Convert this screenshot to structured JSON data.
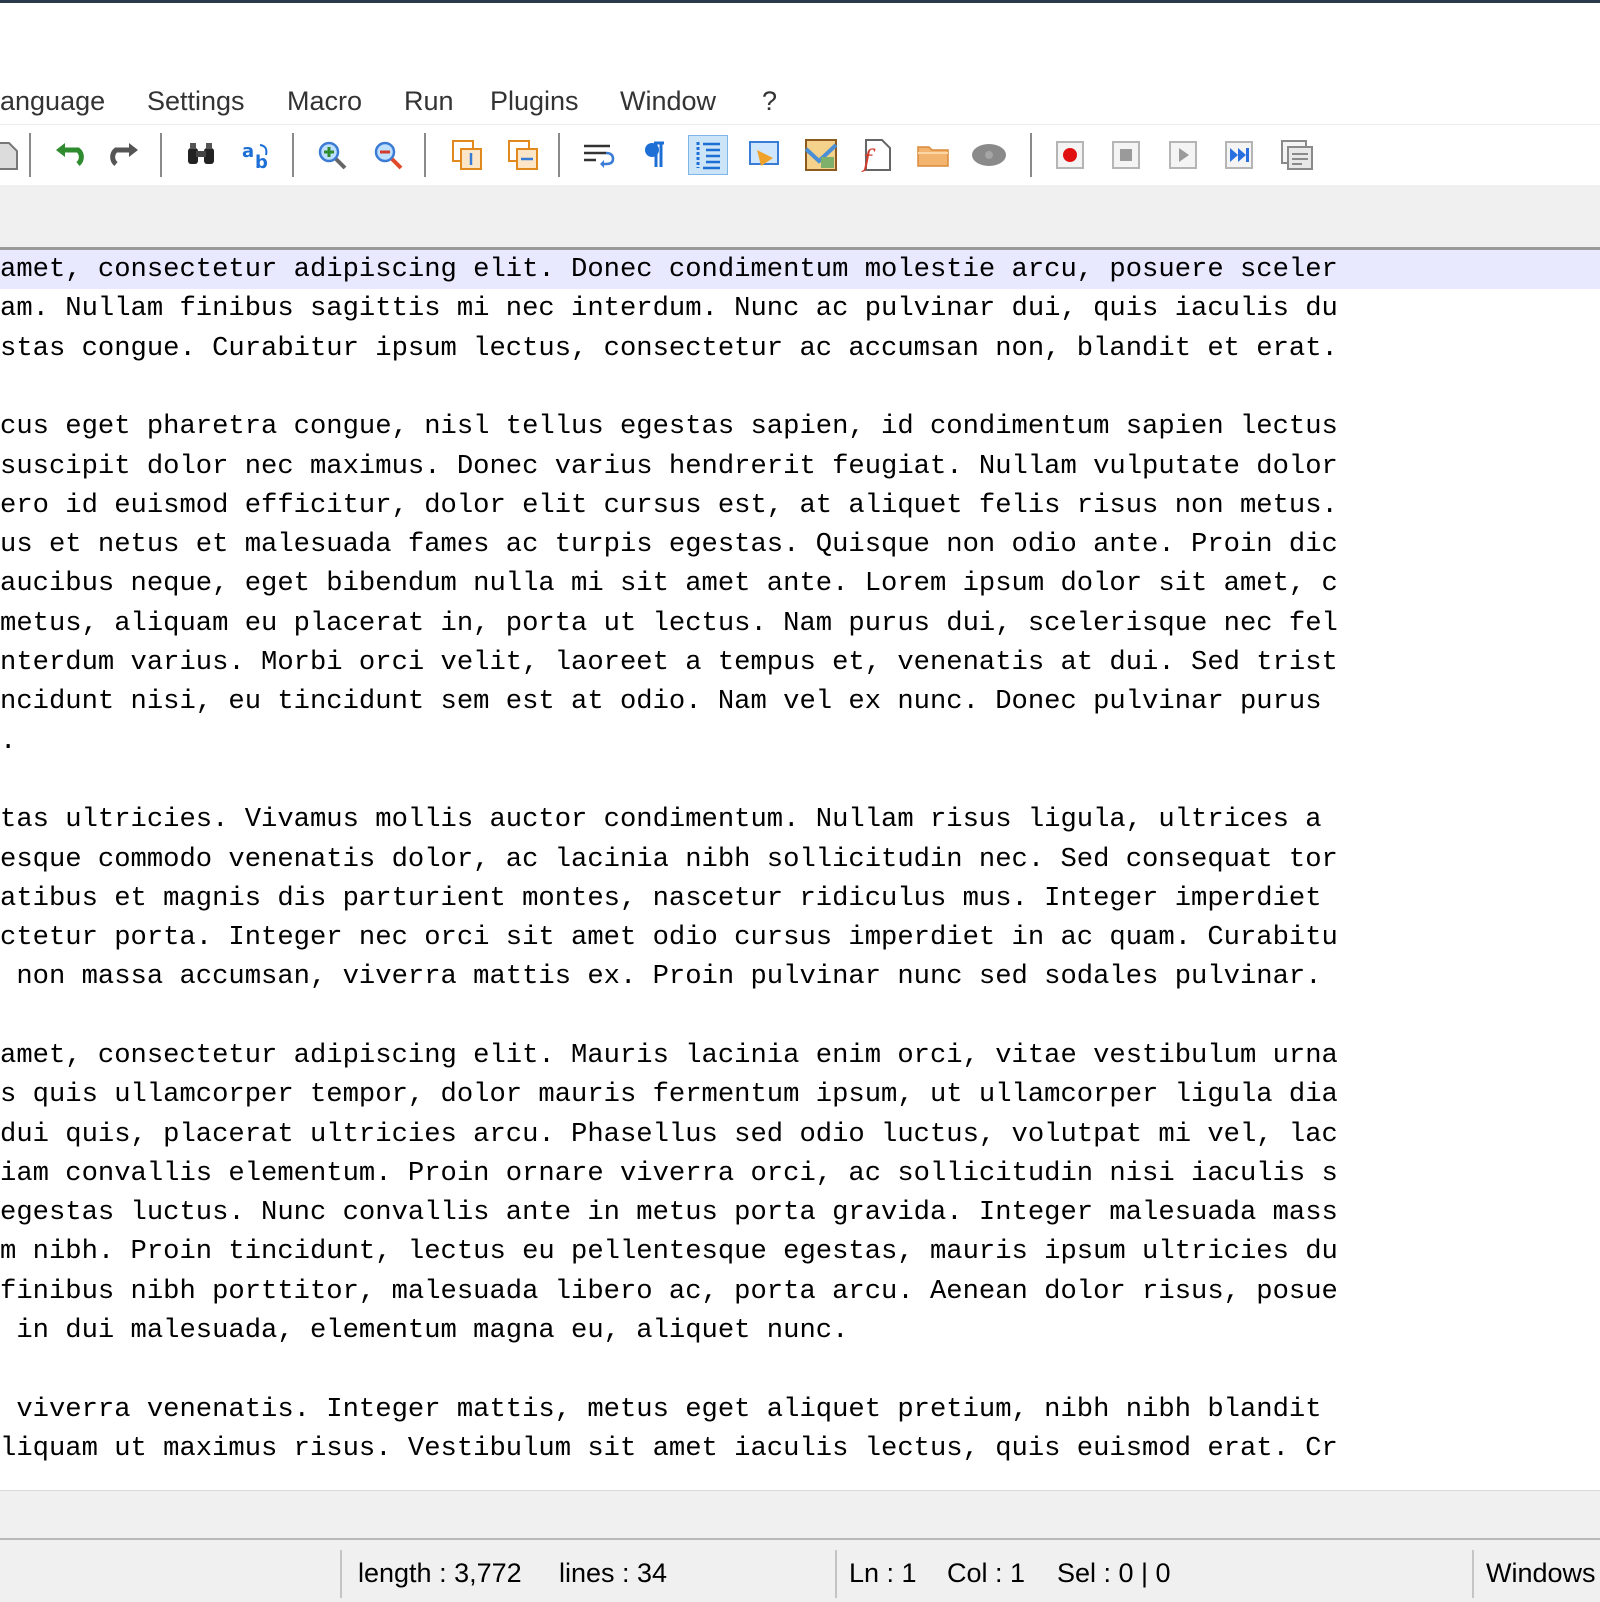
{
  "menu": {
    "items": [
      "anguage",
      "Settings",
      "Macro",
      "Run",
      "Plugins",
      "Window",
      "?"
    ]
  },
  "toolbar": {
    "icons": [
      "partial-file-icon",
      "undo-icon",
      "redo-icon",
      "find-icon",
      "replace-icon",
      "zoom-in-icon",
      "zoom-out-icon",
      "sync-vertical-scroll-icon",
      "sync-horizontal-scroll-icon",
      "word-wrap-icon",
      "show-all-characters-icon",
      "indent-guide-icon",
      "user-defined-language-icon",
      "document-map-icon",
      "function-list-icon",
      "folder-as-workspace-icon",
      "monitoring-icon",
      "record-macro-icon",
      "stop-recording-icon",
      "playback-macro-icon",
      "run-macro-multiple-icon",
      "save-macro-icon"
    ],
    "active_index": 11
  },
  "editor": {
    "current_line": 0,
    "lines": [
      "amet, consectetur adipiscing elit. Donec condimentum molestie arcu, posuere sceler",
      "am. Nullam finibus sagittis mi nec interdum. Nunc ac pulvinar dui, quis iaculis du",
      "stas congue. Curabitur ipsum lectus, consectetur ac accumsan non, blandit et erat.",
      "",
      "cus eget pharetra congue, nisl tellus egestas sapien, id condimentum sapien lectus",
      "suscipit dolor nec maximus. Donec varius hendrerit feugiat. Nullam vulputate dolor",
      "ero id euismod efficitur, dolor elit cursus est, at aliquet felis risus non metus.",
      "us et netus et malesuada fames ac turpis egestas. Quisque non odio ante. Proin dic",
      "aucibus neque, eget bibendum nulla mi sit amet ante. Lorem ipsum dolor sit amet, c",
      "metus, aliquam eu placerat in, porta ut lectus. Nam purus dui, scelerisque nec fel",
      "nterdum varius. Morbi orci velit, laoreet a tempus et, venenatis at dui. Sed trist",
      "ncidunt nisi, eu tincidunt sem est at odio. Nam vel ex nunc. Donec pulvinar purus",
      ".",
      "",
      "tas ultricies. Vivamus mollis auctor condimentum. Nullam risus ligula, ultrices a",
      "esque commodo venenatis dolor, ac lacinia nibh sollicitudin nec. Sed consequat tor",
      "atibus et magnis dis parturient montes, nascetur ridiculus mus. Integer imperdiet",
      "ctetur porta. Integer nec orci sit amet odio cursus imperdiet in ac quam. Curabitu",
      " non massa accumsan, viverra mattis ex. Proin pulvinar nunc sed sodales pulvinar.",
      "",
      "amet, consectetur adipiscing elit. Mauris lacinia enim orci, vitae vestibulum urna",
      "s quis ullamcorper tempor, dolor mauris fermentum ipsum, ut ullamcorper ligula dia",
      "dui quis, placerat ultricies arcu. Phasellus sed odio luctus, volutpat mi vel, lac",
      "iam convallis elementum. Proin ornare viverra orci, ac sollicitudin nisi iaculis s",
      "egestas luctus. Nunc convallis ante in metus porta gravida. Integer malesuada mass",
      "m nibh. Proin tincidunt, lectus eu pellentesque egestas, mauris ipsum ultricies du",
      "finibus nibh porttitor, malesuada libero ac, porta arcu. Aenean dolor risus, posue",
      " in dui malesuada, elementum magna eu, aliquet nunc.",
      "",
      " viverra venenatis. Integer mattis, metus eget aliquet pretium, nibh nibh blandit",
      "liquam ut maximus risus. Vestibulum sit amet iaculis lectus, quis euismod erat. Cr"
    ]
  },
  "status": {
    "length": "length : 3,772",
    "lines": "lines : 34",
    "ln": "Ln : 1",
    "col": "Col : 1",
    "sel": "Sel : 0 | 0",
    "eol": "Windows"
  }
}
